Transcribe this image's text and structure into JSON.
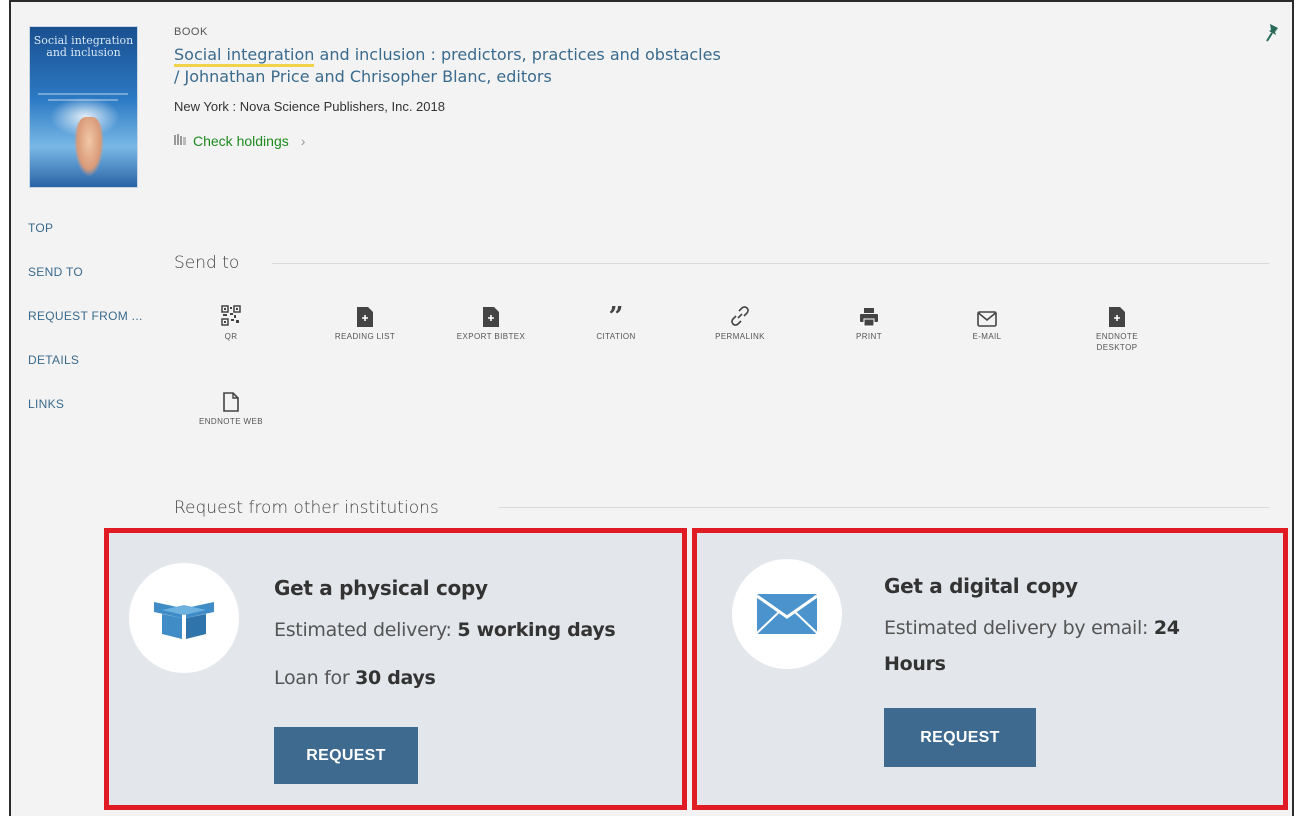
{
  "record": {
    "doc_type": "BOOK",
    "title_highlight": "Social integration",
    "title_rest": " and inclusion : predictors, practices and obstacles",
    "title_line2": "/ Johnathan Price and Chrisopher Blanc, editors",
    "publication": "New York : Nova Science Publishers, Inc.  2018",
    "check_holdings": "Check holdings",
    "cover_text": "Social integration and inclusion"
  },
  "left_nav": [
    "TOP",
    "SEND TO",
    "REQUEST FROM ...",
    "DETAILS",
    "LINKS"
  ],
  "send_to": {
    "heading": "Send to",
    "actions": [
      {
        "label": "QR",
        "icon": "qr-code-icon"
      },
      {
        "label": "READING LIST",
        "icon": "document-icon"
      },
      {
        "label": "EXPORT BIBTEX",
        "icon": "document-icon"
      },
      {
        "label": "CITATION",
        "icon": "quote-icon"
      },
      {
        "label": "PERMALINK",
        "icon": "link-icon"
      },
      {
        "label": "PRINT",
        "icon": "printer-icon"
      },
      {
        "label": "E-MAIL",
        "icon": "envelope-icon"
      },
      {
        "label": "ENDNOTE DESKTOP",
        "icon": "document-icon"
      },
      {
        "label": "ENDNOTE WEB",
        "icon": "document-outline-icon"
      }
    ]
  },
  "request": {
    "heading": "Request from other institutions",
    "physical": {
      "title": "Get a physical copy",
      "delivery_prefix": "Estimated delivery: ",
      "delivery_value": "5 working days",
      "loan_prefix": "Loan for ",
      "loan_value": "30 days",
      "button": "REQUEST",
      "icon": "box-icon"
    },
    "digital": {
      "title": "Get a digital copy",
      "delivery_prefix": "Estimated delivery by email: ",
      "delivery_value": "24",
      "delivery_value2": "Hours",
      "button": "REQUEST",
      "icon": "envelope-icon"
    }
  },
  "colors": {
    "link": "#3a6a8d",
    "holdings": "#1e8a1e",
    "button": "#3d6a8e",
    "highlight_border": "#e01b24",
    "card_bg": "#e3e7ec"
  }
}
